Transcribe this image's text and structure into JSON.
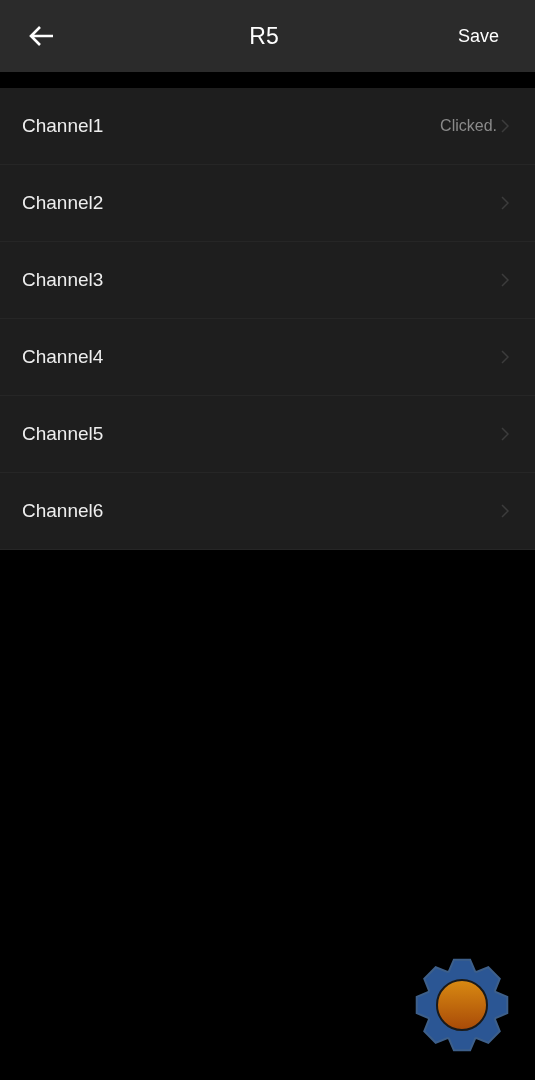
{
  "header": {
    "title": "R5",
    "action": "Save"
  },
  "channels": [
    {
      "name": "Channel1",
      "status": "Clicked."
    },
    {
      "name": "Channel2"
    },
    {
      "name": "Channel3"
    },
    {
      "name": "Channel4"
    },
    {
      "name": "Channel5"
    },
    {
      "name": "Channel6"
    }
  ]
}
